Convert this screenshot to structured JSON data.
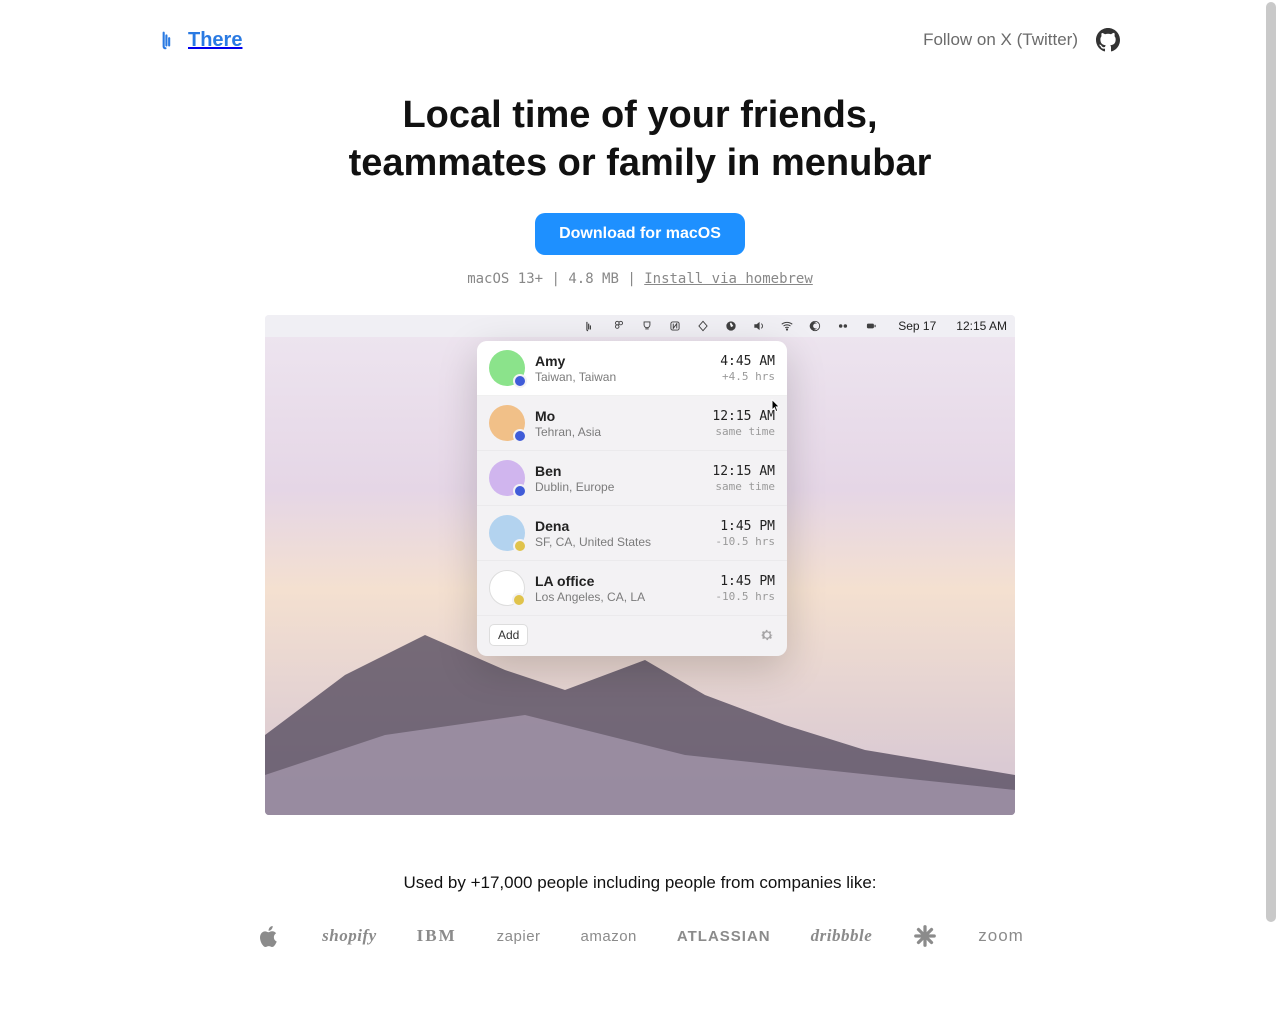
{
  "header": {
    "brand_name": "There",
    "follow_label": "Follow on X (Twitter)"
  },
  "hero": {
    "title_line1": "Local time of your friends,",
    "title_line2": "teammates or family in menubar",
    "download_label": "Download for macOS",
    "meta_os": "macOS 13+",
    "meta_size": "4.8 MB",
    "meta_homebrew": "Install via homebrew",
    "meta_sep": " | "
  },
  "menubar": {
    "date": "Sep 17",
    "time": "12:15 AM"
  },
  "popover": {
    "footer_add": "Add",
    "rows": [
      {
        "name": "Amy",
        "loc": "Taiwan, Taiwan",
        "time": "4:45 AM",
        "offset": "+4.5 hrs",
        "avatar": "green",
        "badge": "blue",
        "selected": true
      },
      {
        "name": "Mo",
        "loc": "Tehran, Asia",
        "time": "12:15 AM",
        "offset": "same time",
        "avatar": "orange",
        "badge": "blue",
        "selected": false
      },
      {
        "name": "Ben",
        "loc": "Dublin, Europe",
        "time": "12:15 AM",
        "offset": "same time",
        "avatar": "purple",
        "badge": "blue",
        "selected": false
      },
      {
        "name": "Dena",
        "loc": "SF, CA, United States",
        "time": "1:45 PM",
        "offset": "-10.5 hrs",
        "avatar": "blue",
        "badge": "yel",
        "selected": false
      },
      {
        "name": "LA office",
        "loc": "Los Angeles, CA, LA",
        "time": "1:45 PM",
        "offset": "-10.5 hrs",
        "avatar": "flag",
        "badge": "yel",
        "selected": false
      }
    ]
  },
  "social": {
    "line": "Used by +17,000 people including people from companies like:",
    "companies": [
      "Apple",
      "shopify",
      "IBM",
      "zapier",
      "amazon",
      "ATLASSIAN",
      "dribbble",
      "Loom",
      "zoom"
    ]
  }
}
